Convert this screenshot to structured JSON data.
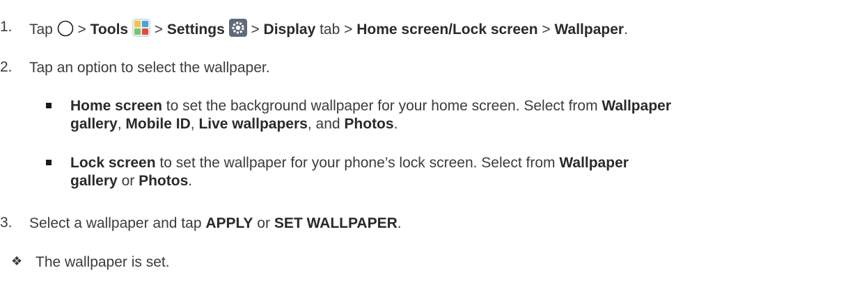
{
  "steps": [
    {
      "number": "1.",
      "parts": {
        "tap": "Tap",
        "sep1": ">",
        "tools": "Tools",
        "sep2": ">",
        "settings": "Settings",
        "sep3": ">",
        "display": "Display",
        "tab": "tab",
        "sep4": ">",
        "home_lock": "Home screen/Lock screen",
        "sep5": ">",
        "wallpaper": "Wallpaper",
        "end": "."
      },
      "icons": [
        "circle-home-icon",
        "tools-folder-icon",
        "settings-gear-icon"
      ]
    },
    {
      "number": "2.",
      "text": "Tap an option to select the wallpaper."
    },
    {
      "number": "3.",
      "parts": {
        "pre": "Select a wallpaper and tap",
        "apply": "APPLY",
        "or": "or",
        "set": "SET WALLPAPER",
        "end": "."
      }
    }
  ],
  "bullets": [
    {
      "line1": {
        "home": "Home screen",
        "mid": "to set the background wallpaper for your home screen. Select from",
        "wallpaper": "Wallpaper"
      },
      "line2": {
        "gallery": "gallery",
        "c1": ",",
        "mobile_id": "Mobile ID",
        "c2": ",",
        "live": "Live wallpapers",
        "and": ", and",
        "photos": "Photos",
        "end": "."
      }
    },
    {
      "line1": {
        "lock": "Lock screen",
        "mid": "to set the wallpaper for your phone’s lock screen. Select from",
        "wallpaper": "Wallpaper"
      },
      "line2": {
        "gallery": "gallery",
        "or": "or",
        "photos": "Photos",
        "end": "."
      }
    }
  ],
  "result": {
    "symbol": "❖",
    "text": "The wallpaper is set."
  }
}
